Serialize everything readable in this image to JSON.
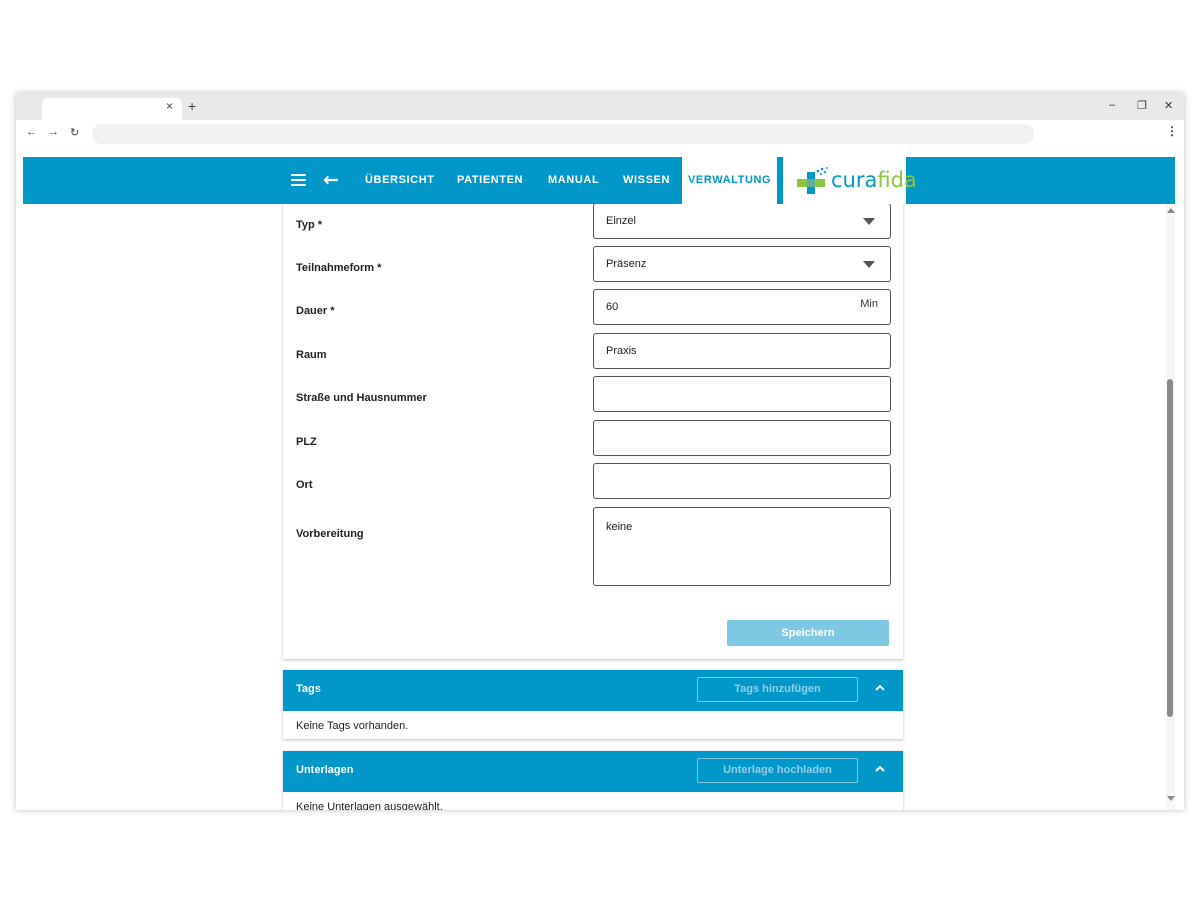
{
  "browser": {
    "tab_close": "×",
    "tab_new": "+",
    "window_controls": {
      "minimize": "–",
      "restore": "❐",
      "close": "✕"
    },
    "nav": {
      "back": "←",
      "forward": "→",
      "reload": "↻"
    },
    "menu": "⋮"
  },
  "appbar": {
    "back_icon": "←",
    "nav_items": [
      "ÜBERSICHT",
      "PATIENTEN",
      "MANUAL",
      "WISSEN",
      "VERWALTUNG"
    ],
    "active_item": "VERWALTUNG",
    "logo": {
      "part1": "cura",
      "part2": "fida"
    },
    "colors": {
      "primary": "#0297c9",
      "logo_green": "#8cc63f"
    }
  },
  "form": {
    "fields": [
      {
        "label": "Typ *",
        "value": "Einzel",
        "kind": "select"
      },
      {
        "label": "Teilnahmeform *",
        "value": "Präsenz",
        "kind": "select"
      },
      {
        "label": "Dauer *",
        "value": "60",
        "suffix": "Min",
        "kind": "number"
      },
      {
        "label": "Raum",
        "value": "Praxis",
        "kind": "text"
      },
      {
        "label": "Straße und Hausnummer",
        "value": "",
        "kind": "text"
      },
      {
        "label": "PLZ",
        "value": "",
        "kind": "text"
      },
      {
        "label": "Ort",
        "value": "",
        "kind": "text"
      },
      {
        "label": "Vorbereitung",
        "value": "keine",
        "kind": "textarea"
      }
    ],
    "save_label": "Speichern"
  },
  "tags": {
    "title": "Tags",
    "button": "Tags hinzufügen",
    "empty_text": "Keine Tags vorhanden."
  },
  "unterlagen": {
    "title": "Unterlagen",
    "button": "Unterlage hochladen",
    "empty_text": "Keine Unterlagen ausgewählt."
  }
}
